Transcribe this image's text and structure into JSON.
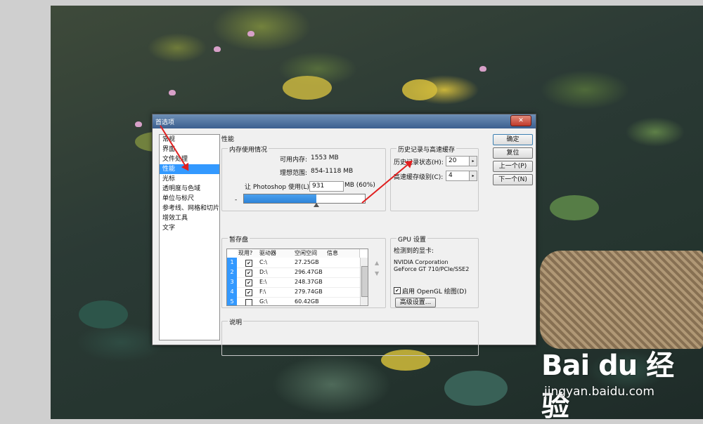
{
  "dialog": {
    "title": "首选项",
    "close_label": "✕"
  },
  "categories": [
    {
      "label": "常规",
      "selected": false
    },
    {
      "label": "界面",
      "selected": false
    },
    {
      "label": "文件处理",
      "selected": false
    },
    {
      "label": "性能",
      "selected": true
    },
    {
      "label": "光标",
      "selected": false
    },
    {
      "label": "透明度与色域",
      "selected": false
    },
    {
      "label": "单位与标尺",
      "selected": false
    },
    {
      "label": "参考线、网格和切片",
      "selected": false
    },
    {
      "label": "增效工具",
      "selected": false
    },
    {
      "label": "文字",
      "selected": false
    }
  ],
  "section_title": "性能",
  "memory": {
    "title": "内存使用情况",
    "available_label": "可用内存:",
    "available_value": "1553 MB",
    "ideal_label": "理想范围:",
    "ideal_value": "854-1118 MB",
    "let_label": "让 Photoshop 使用(L):",
    "let_value": "931",
    "unit_pct": "MB (60%)",
    "slider_min": "-",
    "slider_fraction": 0.6
  },
  "history": {
    "title": "历史记录与高速缓存",
    "states_label": "历史记录状态(H):",
    "states_value": "20",
    "cache_label": "高速缓存级别(C):",
    "cache_value": "4"
  },
  "scratch": {
    "title": "暂存盘",
    "columns": [
      "现用?",
      "驱动器",
      "空闲空间",
      "信息"
    ],
    "rows": [
      {
        "num": "1",
        "checked": true,
        "drive": "C:\\",
        "free": "27.25GB"
      },
      {
        "num": "2",
        "checked": true,
        "drive": "D:\\",
        "free": "296.47GB"
      },
      {
        "num": "3",
        "checked": true,
        "drive": "E:\\",
        "free": "248.37GB"
      },
      {
        "num": "4",
        "checked": true,
        "drive": "F:\\",
        "free": "279.74GB"
      },
      {
        "num": "5",
        "checked": false,
        "drive": "G:\\",
        "free": "60.42GB"
      }
    ],
    "up_arrow": "▲",
    "down_arrow": "▼"
  },
  "gpu": {
    "title": "GPU 设置",
    "detected_label": "检测到的显卡:",
    "card_line1": "NVIDIA Corporation",
    "card_line2": "GeForce GT 710/PCIe/SSE2",
    "opengl_label": "启用 OpenGL 绘图(D)",
    "opengl_checked": true,
    "advanced_button": "高级设置..."
  },
  "description": {
    "title": "说明"
  },
  "buttons": {
    "ok": "确定",
    "reset": "复位",
    "prev": "上一个(P)",
    "next": "下一个(N)"
  },
  "watermark": {
    "logo": "Bai du 经验",
    "site": "jingyan.baidu.com"
  },
  "colors": {
    "selection": "#3399ff",
    "annotation_arrow": "#e02020"
  }
}
